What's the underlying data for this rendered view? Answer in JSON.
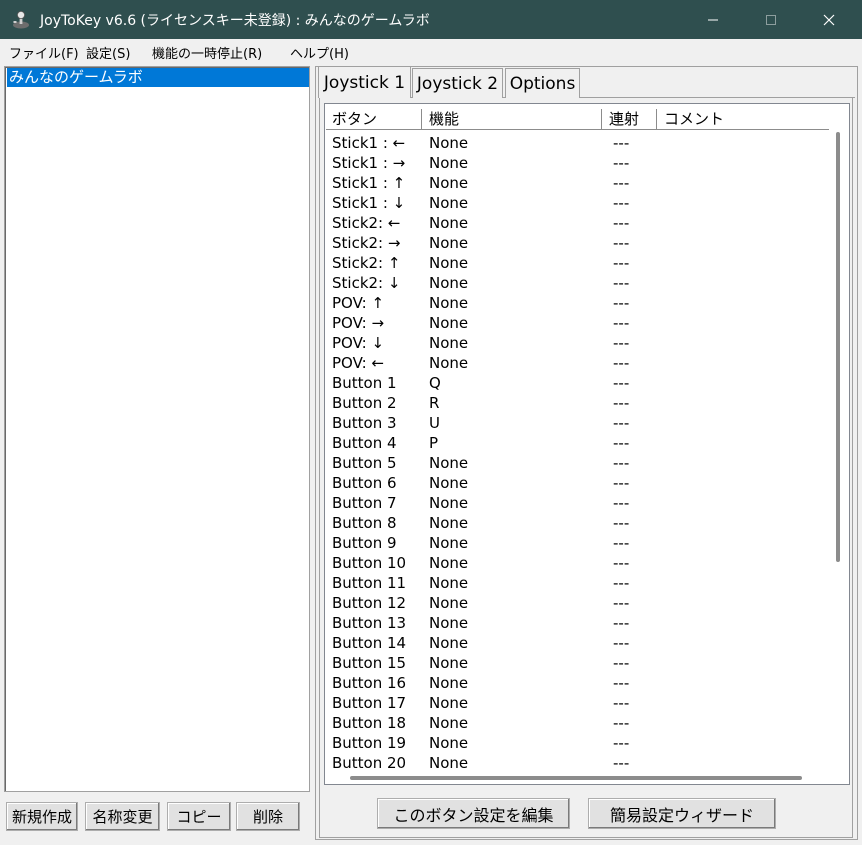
{
  "window": {
    "title": "JoyToKey v6.6 (ライセンスキー未登録) : みんなのゲームラボ",
    "app_icon": "joystick-icon",
    "controls": {
      "minimize": "—",
      "maximize": "☐",
      "close": "✕"
    }
  },
  "menu": [
    "ファイル(F)",
    "設定(S)",
    "機能の一時停止(R)",
    "ヘルプ(H)"
  ],
  "profiles": {
    "items": [
      "みんなのゲームラボ"
    ],
    "selected": "みんなのゲームラボ",
    "buttons": {
      "new": "新規作成",
      "rename": "名称変更",
      "copy": "コピー",
      "delete": "削除"
    }
  },
  "tabs": [
    "Joystick 1",
    "Joystick 2",
    "Options"
  ],
  "active_tab": "Joystick 1",
  "table": {
    "columns": [
      "ボタン",
      "機能",
      "連射",
      "コメント"
    ],
    "rows": [
      [
        "Stick1 : ←",
        "None",
        "---",
        ""
      ],
      [
        "Stick1 : →",
        "None",
        "---",
        ""
      ],
      [
        "Stick1 : ↑",
        "None",
        "---",
        ""
      ],
      [
        "Stick1 : ↓",
        "None",
        "---",
        ""
      ],
      [
        "Stick2: ←",
        "None",
        "---",
        ""
      ],
      [
        "Stick2: →",
        "None",
        "---",
        ""
      ],
      [
        "Stick2: ↑",
        "None",
        "---",
        ""
      ],
      [
        "Stick2: ↓",
        "None",
        "---",
        ""
      ],
      [
        "POV: ↑",
        "None",
        "---",
        ""
      ],
      [
        "POV: →",
        "None",
        "---",
        ""
      ],
      [
        "POV: ↓",
        "None",
        "---",
        ""
      ],
      [
        "POV: ←",
        "None",
        "---",
        ""
      ],
      [
        "Button 1",
        "Q",
        "---",
        ""
      ],
      [
        "Button 2",
        "R",
        "---",
        ""
      ],
      [
        "Button 3",
        "U",
        "---",
        ""
      ],
      [
        "Button 4",
        "P",
        "---",
        ""
      ],
      [
        "Button 5",
        "None",
        "---",
        ""
      ],
      [
        "Button 6",
        "None",
        "---",
        ""
      ],
      [
        "Button 7",
        "None",
        "---",
        ""
      ],
      [
        "Button 8",
        "None",
        "---",
        ""
      ],
      [
        "Button 9",
        "None",
        "---",
        ""
      ],
      [
        "Button 10",
        "None",
        "---",
        ""
      ],
      [
        "Button 11",
        "None",
        "---",
        ""
      ],
      [
        "Button 12",
        "None",
        "---",
        ""
      ],
      [
        "Button 13",
        "None",
        "---",
        ""
      ],
      [
        "Button 14",
        "None",
        "---",
        ""
      ],
      [
        "Button 15",
        "None",
        "---",
        ""
      ],
      [
        "Button 16",
        "None",
        "---",
        ""
      ],
      [
        "Button 17",
        "None",
        "---",
        ""
      ],
      [
        "Button 18",
        "None",
        "---",
        ""
      ],
      [
        "Button 19",
        "None",
        "---",
        ""
      ],
      [
        "Button 20",
        "None",
        "---",
        ""
      ]
    ]
  },
  "actions": {
    "edit": "このボタン設定を編集",
    "wizard": "簡易設定ウィザード"
  },
  "colors": {
    "titlebar": "#2f4f4f",
    "selection": "#0078d7"
  }
}
